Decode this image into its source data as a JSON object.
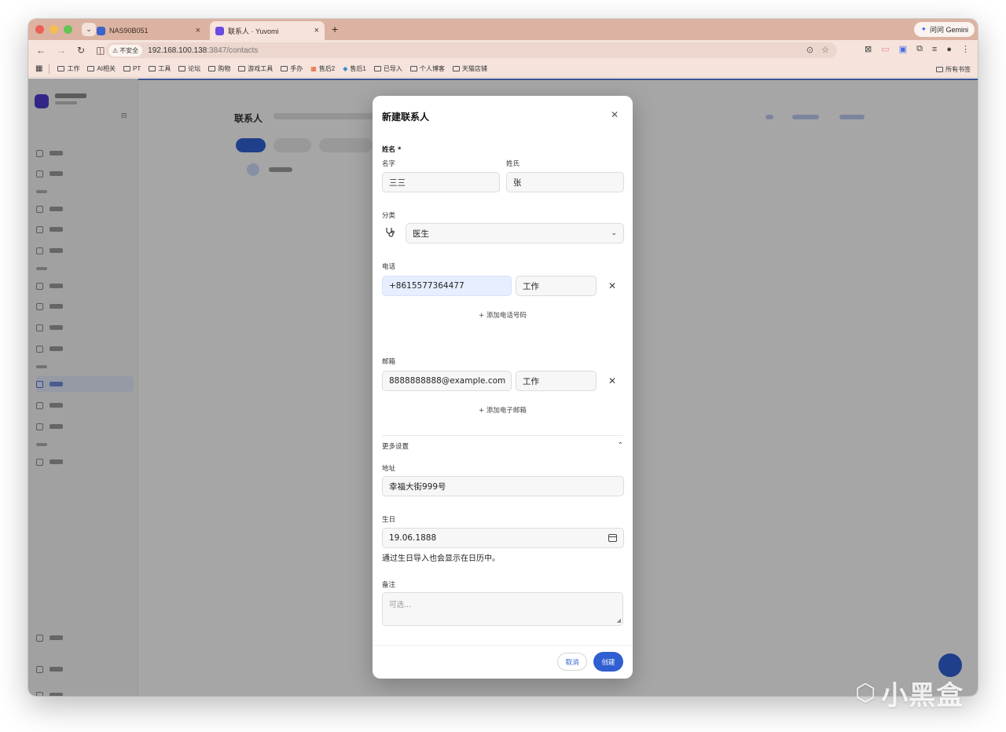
{
  "browser": {
    "tabs": [
      {
        "title": "NAS90B051",
        "favicon_color": "#3c63c9"
      },
      {
        "title": "联系人 · Yuvomi",
        "favicon_color": "#6a4ae0"
      }
    ],
    "gemini_label": "问问 Gemini",
    "insecure_label": "不安全",
    "url_host": "192.168.100.138",
    "url_path": ":3847/contacts",
    "bookmarks": [
      "工作",
      "AI相关",
      "PT",
      "工具",
      "论坛",
      "购物",
      "游戏工具",
      "手办",
      "售后2",
      "售后1",
      "已导入",
      "个人博客",
      "天猫店铺"
    ],
    "all_bookmarks_label": "所有书签"
  },
  "modal": {
    "title": "新建联系人",
    "name_section_label": "姓名 *",
    "first_name_label": "名字",
    "last_name_label": "姓氏",
    "first_name_value": "三三",
    "last_name_value": "张",
    "category_label": "分类",
    "category_value": "医生",
    "phone_label": "电话",
    "phone_value": "+8615577364477",
    "phone_type": "工作",
    "add_phone_label": "+ 添加电话号码",
    "email_label": "邮箱",
    "email_value": "8888888888@example.com",
    "email_type": "工作",
    "add_email_label": "+ 添加电子邮箱",
    "more_settings_label": "更多设置",
    "address_label": "地址",
    "address_value": "幸福大街999号",
    "birthday_label": "生日",
    "birthday_value": "19.06.1888",
    "birthday_hint": "通过生日导入也会显示在日历中。",
    "notes_label": "备注",
    "notes_placeholder": "可选...",
    "cancel_label": "取消",
    "create_label": "创建"
  },
  "background_page": {
    "title": "联系人"
  },
  "watermark": "小黑盒",
  "colors": {
    "primary": "#2f5fd0",
    "tabstrip": "#dcb3a3",
    "overlay": "rgba(0,0,0,0.33)"
  }
}
